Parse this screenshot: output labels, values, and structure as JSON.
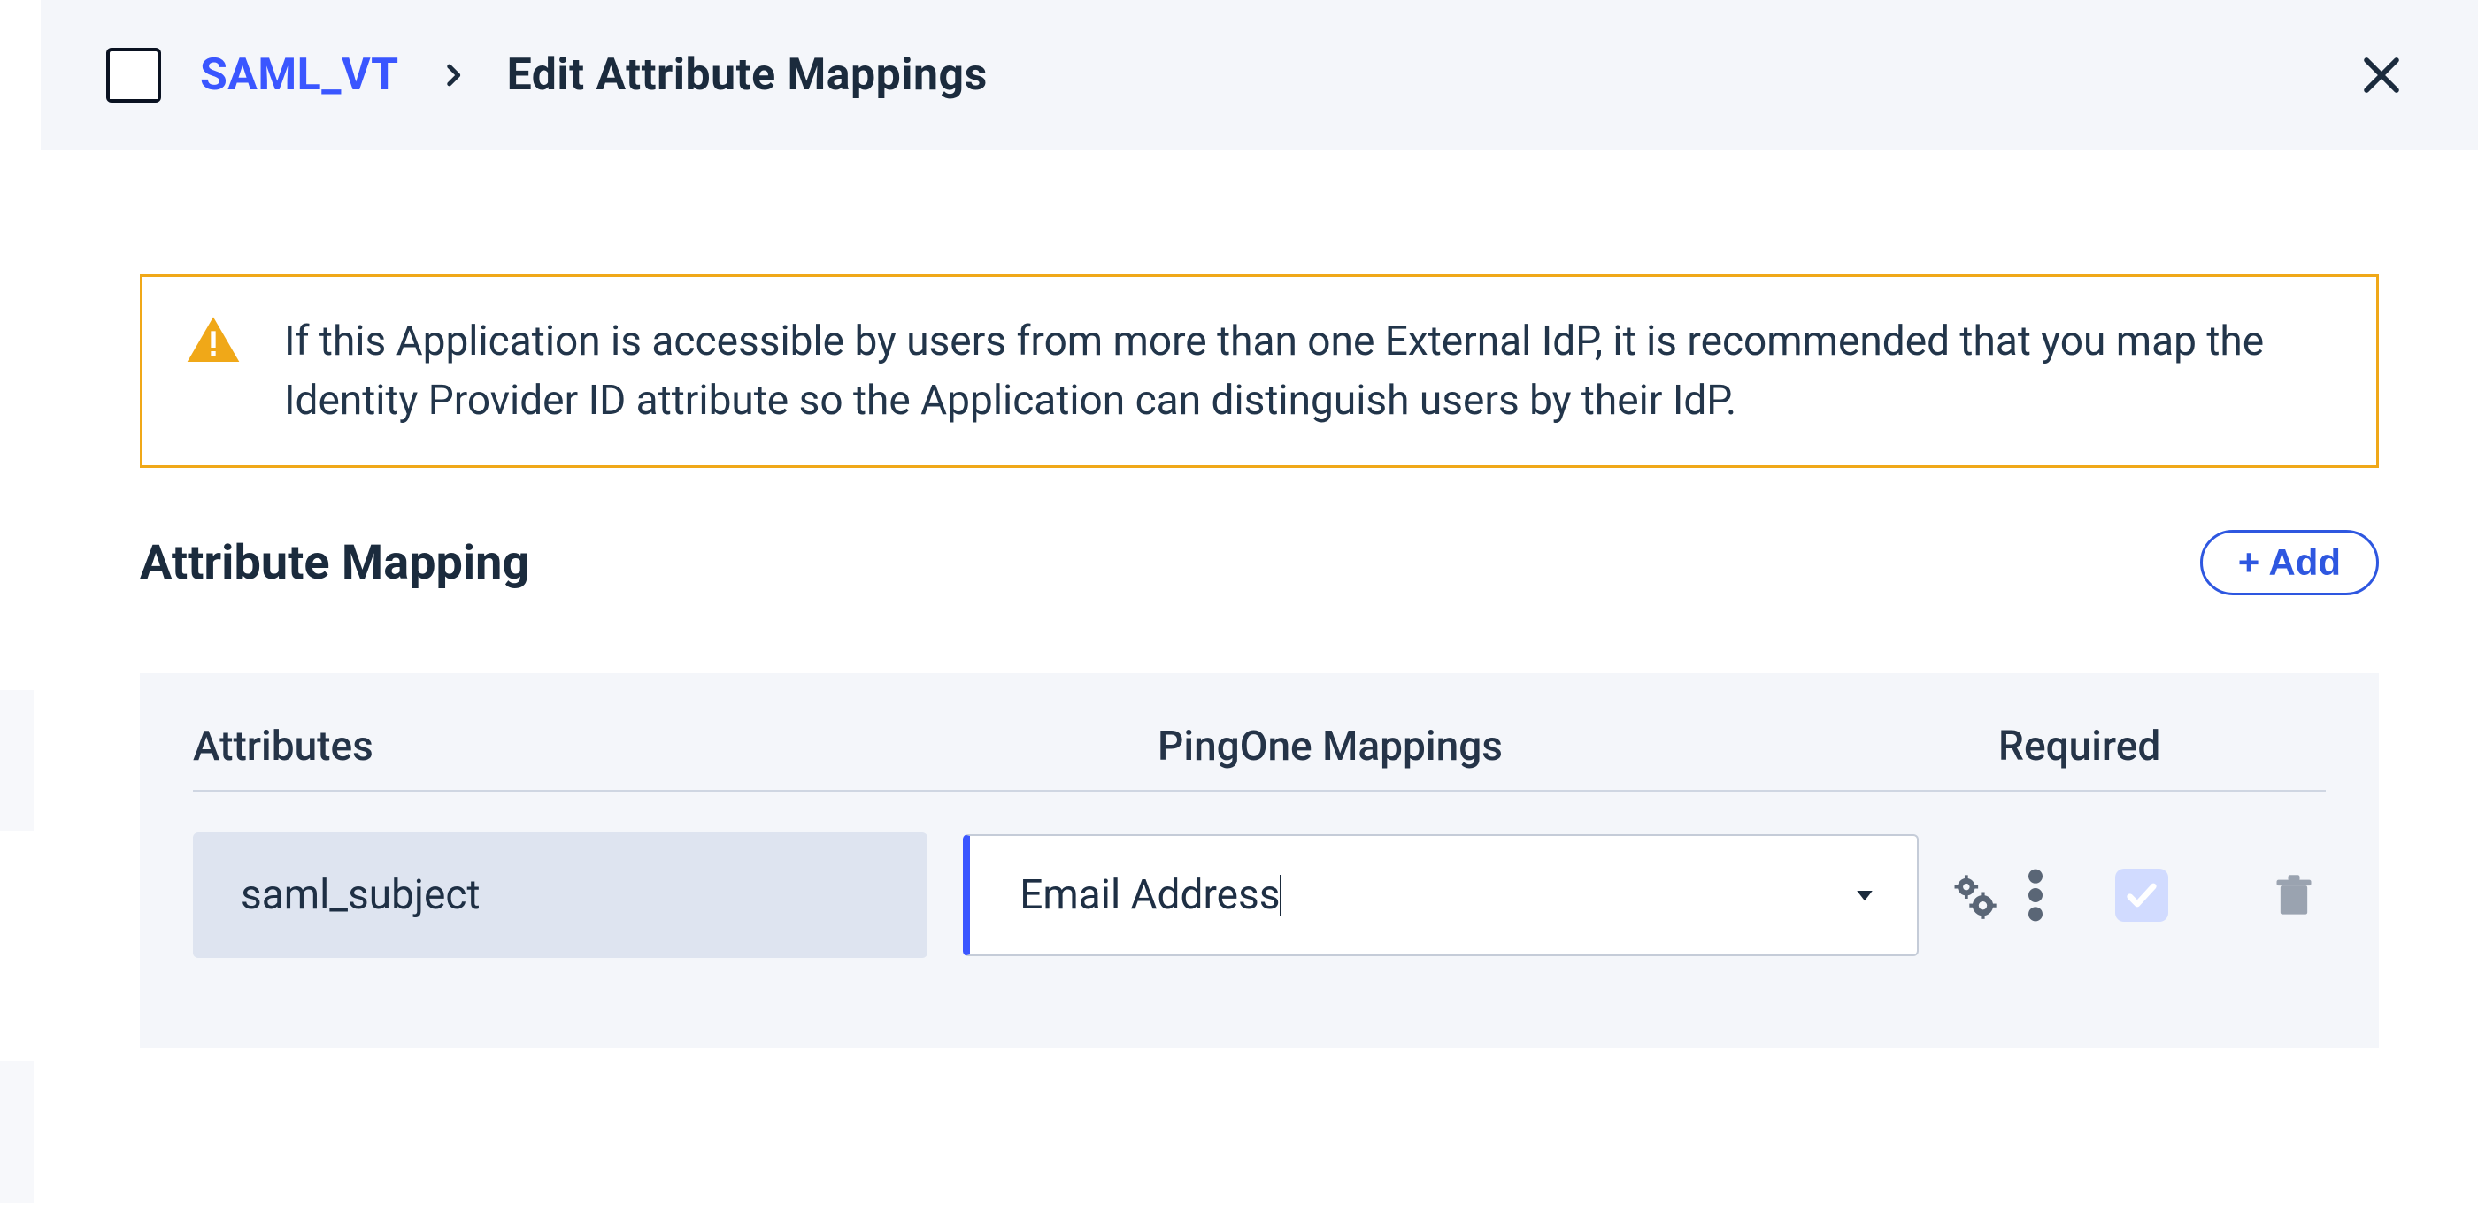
{
  "breadcrumb": {
    "app_name": "SAML_VT",
    "page_title": "Edit Attribute Mappings"
  },
  "alert": {
    "message": "If this Application is accessible by users from more than one External IdP, it is recommended that you map the Identity Provider ID attribute so the Application can distinguish users by their IdP."
  },
  "section": {
    "title": "Attribute Mapping",
    "add_label": "+ Add"
  },
  "table": {
    "headers": {
      "attributes": "Attributes",
      "mappings": "PingOne Mappings",
      "required": "Required"
    },
    "rows": [
      {
        "attribute": "saml_subject",
        "mapping_value": "Email Address",
        "required_checked": true
      }
    ]
  },
  "icons": {
    "app": "browser-icon",
    "close": "close-icon",
    "chevron": "chevron-right-icon",
    "warning": "warning-triangle-icon",
    "gears": "advanced-settings-icon",
    "more": "more-vertical-icon",
    "caret": "caret-down-icon",
    "check": "check-icon",
    "trash": "trash-icon"
  }
}
